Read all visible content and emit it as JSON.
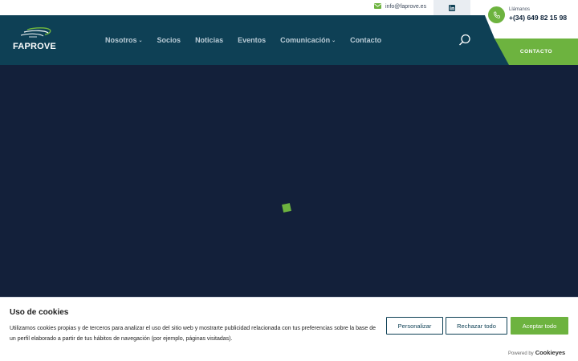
{
  "topbar": {
    "email": "info@faprove.es",
    "mail_icon": "mail-icon",
    "linkedin_icon": "linkedin-icon"
  },
  "header": {
    "logo_text": "FAPROVE",
    "nav": [
      {
        "label": "Nosotros",
        "has_dropdown": true
      },
      {
        "label": "Socios",
        "has_dropdown": false
      },
      {
        "label": "Noticias",
        "has_dropdown": false
      },
      {
        "label": "Eventos",
        "has_dropdown": false
      },
      {
        "label": "Comunicación",
        "has_dropdown": true
      },
      {
        "label": "Contacto",
        "has_dropdown": false
      }
    ],
    "search_icon": "search-icon"
  },
  "call": {
    "label": "Llámanos",
    "number": "+(34) 649 82 15 98"
  },
  "contact_button": "CONTACTO",
  "cookie": {
    "title": "Uso de cookies",
    "text": "Utilizamos cookies propias y de terceros para analizar el uso del sitio web y mostrarte publicidad relacionada con tus preferencias sobre la base de un perfil elaborado a partir de tus hábitos de navegación (por ejemplo, páginas visitadas).",
    "personalizar": "Personalizar",
    "rechazar": "Rechazar todo",
    "aceptar": "Aceptar todo",
    "powered_by": "Powered by",
    "brand": "Cookieyes"
  },
  "colors": {
    "header_bg": "#0e4055",
    "hero_bg": "#13203a",
    "accent_green": "#6db33f"
  }
}
